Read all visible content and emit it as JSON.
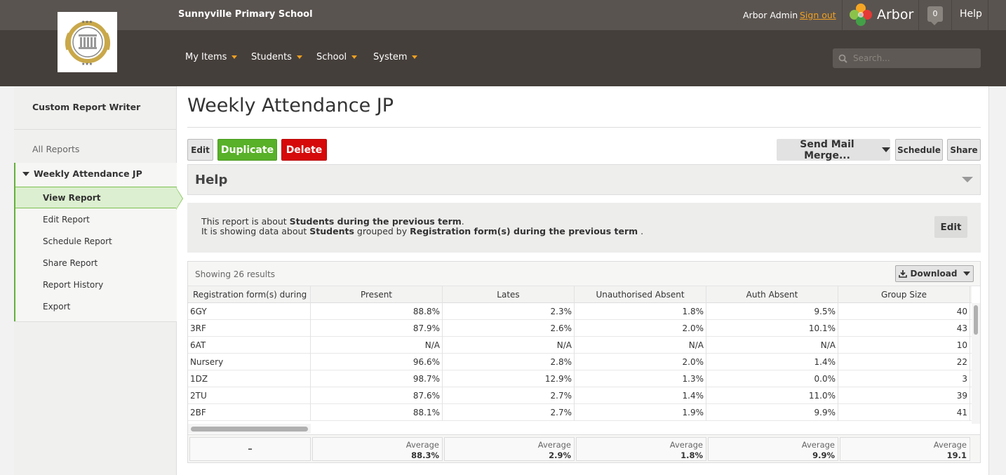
{
  "header": {
    "school_name": "Sunnyville Primary School",
    "user_name": "Arbor Admin",
    "signout_label": "Sign out",
    "brand_name": "Arbor",
    "notification_count": "0",
    "help_label": "Help",
    "menu": [
      {
        "label": "My Items"
      },
      {
        "label": "Students"
      },
      {
        "label": "School"
      },
      {
        "label": "System"
      }
    ],
    "search_placeholder": "Search..."
  },
  "sidebar": {
    "title": "Custom Report Writer",
    "all_reports": "All Reports",
    "group_title": "Weekly Attendance JP",
    "items": [
      {
        "label": "View Report",
        "active": true
      },
      {
        "label": "Edit Report"
      },
      {
        "label": "Schedule Report"
      },
      {
        "label": "Share Report"
      },
      {
        "label": "Report History"
      },
      {
        "label": "Export"
      }
    ]
  },
  "page": {
    "title": "Weekly Attendance JP",
    "buttons": {
      "edit": "Edit",
      "duplicate": "Duplicate",
      "delete": "Delete",
      "mail_merge": "Send Mail Merge...",
      "schedule": "Schedule",
      "share": "Share"
    },
    "help_title": "Help",
    "about": {
      "line1_prefix": "This report is about ",
      "line1_bold": "Students during the previous term",
      "line1_suffix": ".",
      "line2_prefix": "It is showing data about ",
      "line2_bold1": "Students",
      "line2_mid": " grouped by ",
      "line2_bold2": "Registration form(s) during the previous term",
      "line2_suffix": " .",
      "edit_label": "Edit"
    }
  },
  "table": {
    "showing": "Showing 26 results",
    "download_label": "Download",
    "columns": [
      "Registration form(s) during ...",
      "Present",
      "Lates",
      "Unauthorised Absent",
      "Auth Absent",
      "Group Size"
    ],
    "rows": [
      [
        "6GY",
        "88.8%",
        "2.3%",
        "1.8%",
        "9.5%",
        "40"
      ],
      [
        "3RF",
        "87.9%",
        "2.6%",
        "2.0%",
        "10.1%",
        "43"
      ],
      [
        "6AT",
        "N/A",
        "N/A",
        "N/A",
        "N/A",
        "10"
      ],
      [
        "Nursery",
        "96.6%",
        "2.8%",
        "2.0%",
        "1.4%",
        "22"
      ],
      [
        "1DZ",
        "98.7%",
        "12.9%",
        "1.3%",
        "0.0%",
        "3"
      ],
      [
        "2TU",
        "87.6%",
        "2.7%",
        "1.4%",
        "11.0%",
        "39"
      ],
      [
        "2BF",
        "88.1%",
        "2.7%",
        "1.9%",
        "9.9%",
        "41"
      ]
    ],
    "footer": {
      "first": "–",
      "label": "Average",
      "values": [
        "88.3%",
        "2.9%",
        "1.8%",
        "9.9%",
        "19.1"
      ]
    }
  },
  "colors": {
    "topbar": "#5a5450",
    "navbar": "#453f3b",
    "accent_orange": "#f0a020",
    "green": "#58b128",
    "red": "#d60a0a"
  }
}
